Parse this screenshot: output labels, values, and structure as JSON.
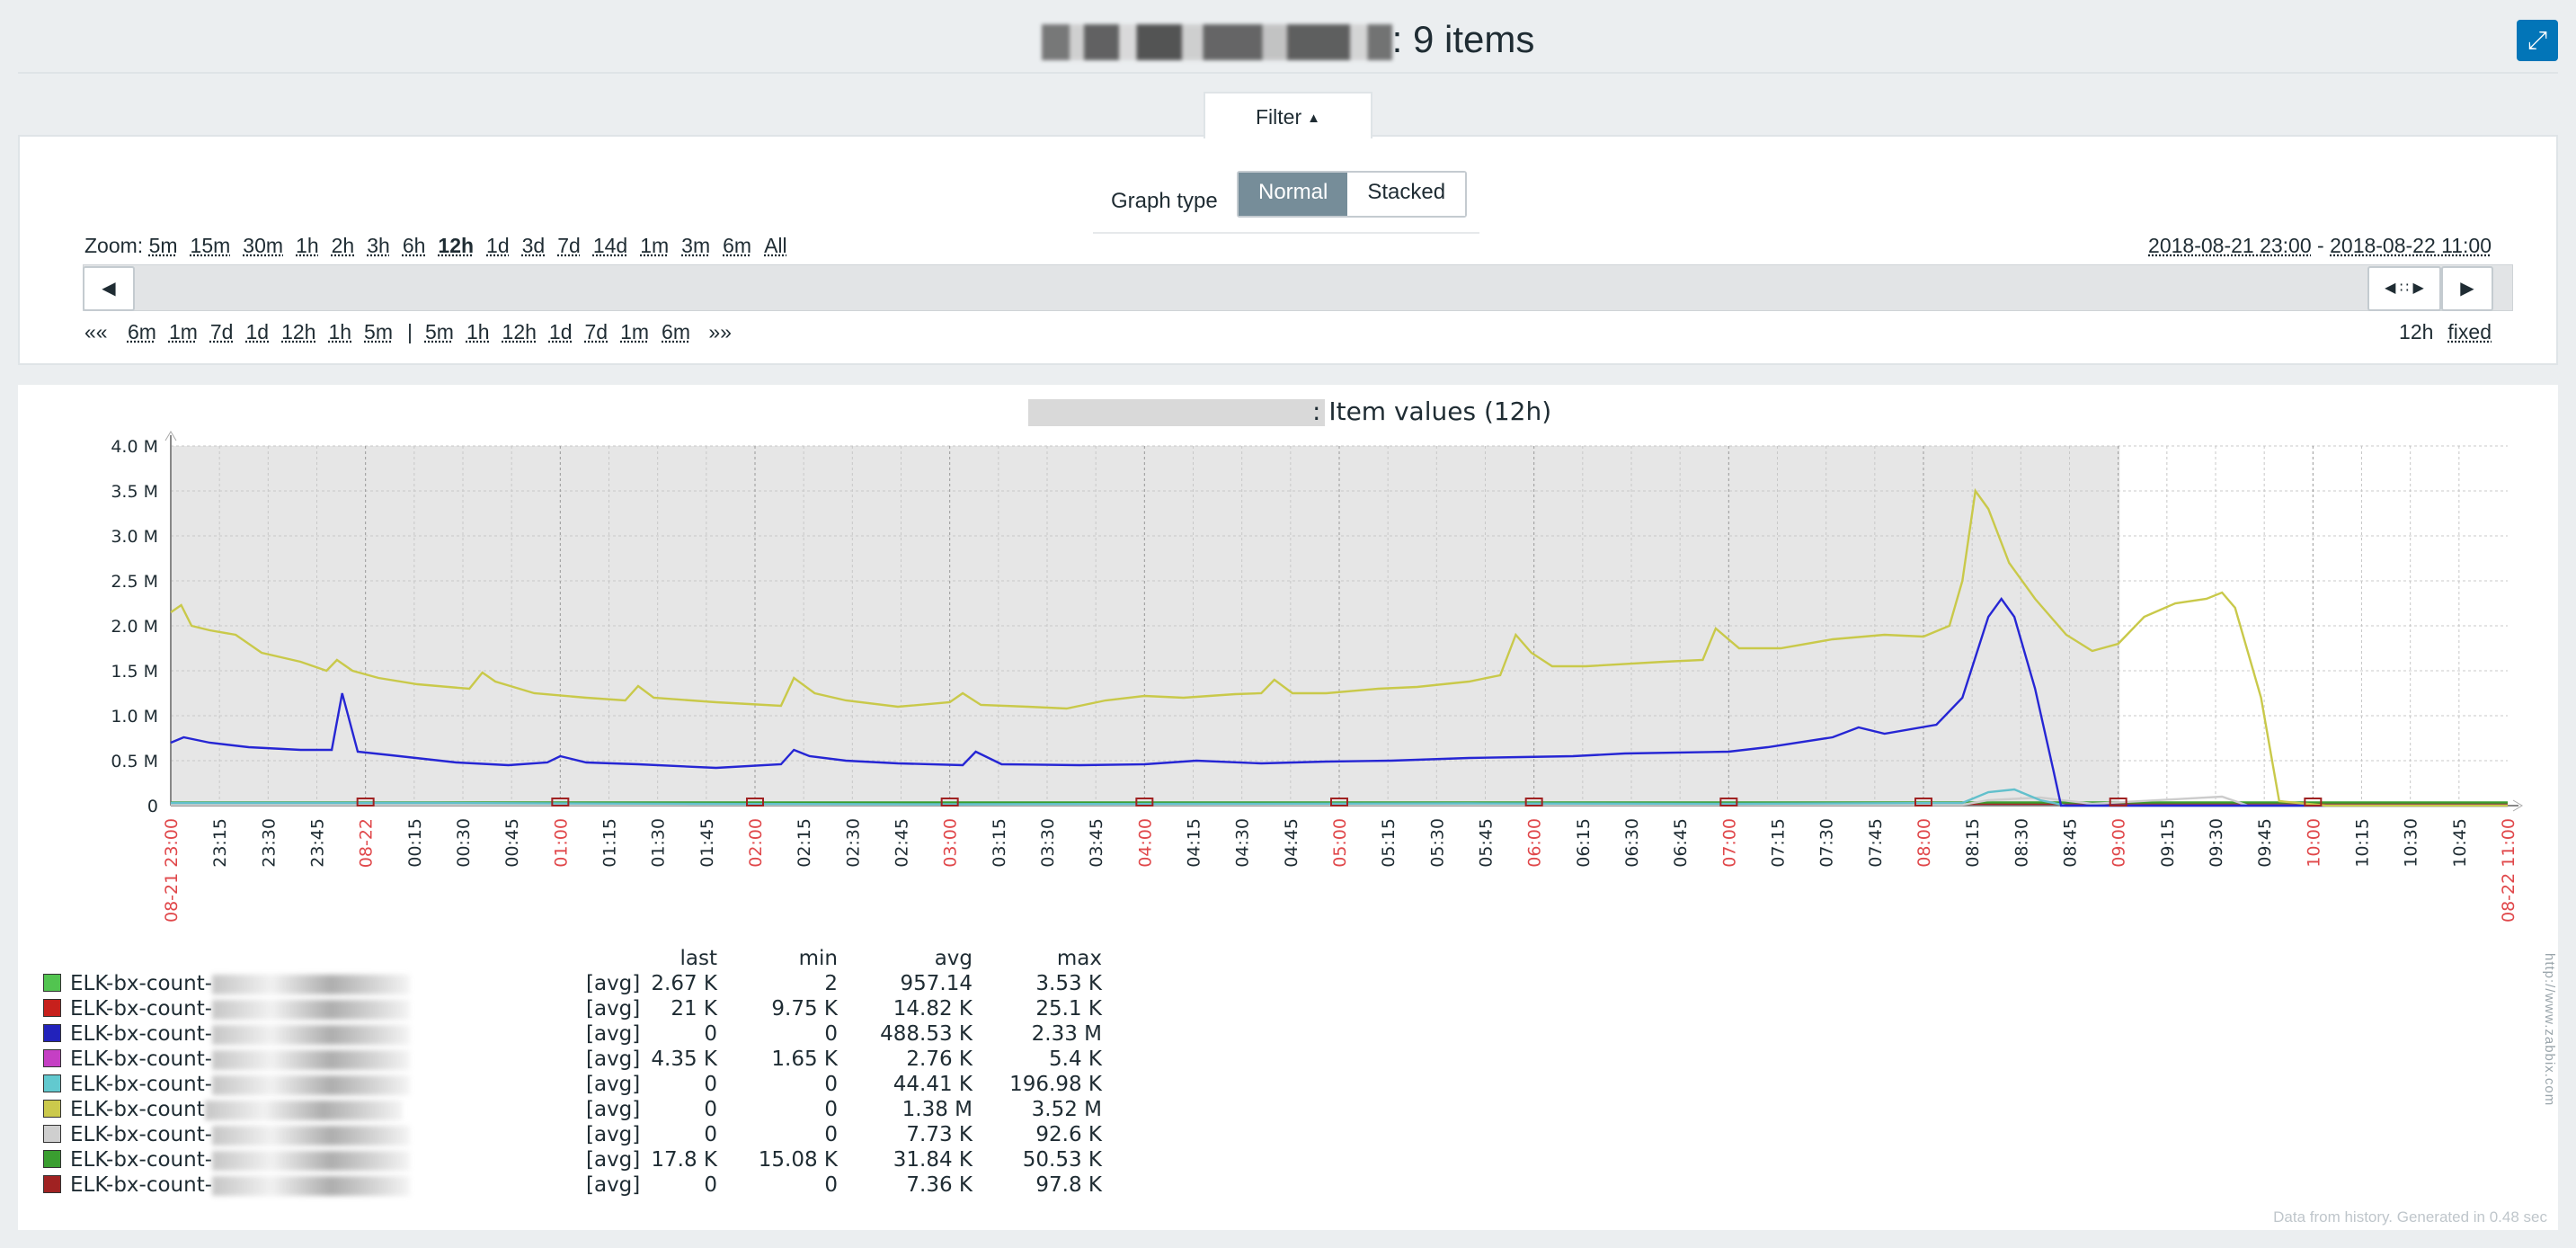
{
  "header": {
    "title_suffix": ": 9 items",
    "fullscreen_icon": "⤢"
  },
  "filter": {
    "tab_label": "Filter",
    "graph_type_label": "Graph type",
    "graph_types": [
      "Normal",
      "Stacked"
    ],
    "graph_type_selected": "Normal",
    "zoom_label": "Zoom:",
    "zoom_options": [
      "5m",
      "15m",
      "30m",
      "1h",
      "2h",
      "3h",
      "6h",
      "12h",
      "1d",
      "3d",
      "7d",
      "14d",
      "1m",
      "3m",
      "6m",
      "All"
    ],
    "zoom_selected": "12h",
    "range_from": "2018-08-21 23:00",
    "range_sep": " - ",
    "range_to": "2018-08-22 11:00",
    "nav_back_label": "««",
    "nav_back": [
      "6m",
      "1m",
      "7d",
      "1d",
      "12h",
      "1h",
      "5m"
    ],
    "nav_sep": "|",
    "nav_forward": [
      "5m",
      "1h",
      "12h",
      "1d",
      "7d",
      "1m",
      "6m"
    ],
    "nav_forward_label": "»»",
    "period": "12h",
    "fixed_label": "fixed"
  },
  "graph": {
    "title_suffix": ": Item values (12h)",
    "footer": "Data from history. Generated in 0.48 sec",
    "watermark": "http://www.zabbix.com",
    "y_ticks": [
      "0",
      "0.5 M",
      "1.0 M",
      "1.5 M",
      "2.0 M",
      "2.5 M",
      "3.0 M",
      "3.5 M",
      "4.0 M"
    ],
    "x_start_label": "08-21 23:00",
    "x_end_label": "08-22 11:00",
    "x_labels": [
      "23:15",
      "23:30",
      "23:45",
      "08-22",
      "00:15",
      "00:30",
      "00:45",
      "01:00",
      "01:15",
      "01:30",
      "01:45",
      "02:00",
      "02:15",
      "02:30",
      "02:45",
      "03:00",
      "03:15",
      "03:30",
      "03:45",
      "04:00",
      "04:15",
      "04:30",
      "04:45",
      "05:00",
      "05:15",
      "05:30",
      "05:45",
      "06:00",
      "06:15",
      "06:30",
      "06:45",
      "07:00",
      "07:15",
      "07:30",
      "07:45",
      "08:00",
      "08:15",
      "08:30",
      "08:45",
      "09:00",
      "09:15",
      "09:30",
      "09:45",
      "10:00",
      "10:15",
      "10:30",
      "10:45"
    ],
    "highlight_labels": [
      "08-22",
      "01:00",
      "02:00",
      "03:00",
      "04:00",
      "05:00",
      "06:00",
      "07:00",
      "08:00",
      "09:00",
      "10:00"
    ]
  },
  "chart_data": {
    "type": "line",
    "title": ": Item values (12h)",
    "ylim": [
      0,
      4000000
    ],
    "x_range": [
      "2018-08-21 23:00",
      "2018-08-22 11:00"
    ],
    "series": [
      {
        "name": "ELK-bx-count-",
        "color": "#c9c94a",
        "points": [
          [
            0,
            2150000
          ],
          [
            4,
            2230000
          ],
          [
            8,
            2000000
          ],
          [
            15,
            1950000
          ],
          [
            25,
            1900000
          ],
          [
            35,
            1700000
          ],
          [
            50,
            1600000
          ],
          [
            60,
            1500000
          ],
          [
            64,
            1620000
          ],
          [
            70,
            1500000
          ],
          [
            80,
            1420000
          ],
          [
            95,
            1350000
          ],
          [
            115,
            1300000
          ],
          [
            120,
            1480000
          ],
          [
            125,
            1380000
          ],
          [
            140,
            1250000
          ],
          [
            160,
            1200000
          ],
          [
            175,
            1170000
          ],
          [
            180,
            1330000
          ],
          [
            186,
            1200000
          ],
          [
            210,
            1150000
          ],
          [
            235,
            1110000
          ],
          [
            240,
            1420000
          ],
          [
            248,
            1250000
          ],
          [
            260,
            1170000
          ],
          [
            280,
            1100000
          ],
          [
            300,
            1150000
          ],
          [
            305,
            1250000
          ],
          [
            312,
            1120000
          ],
          [
            330,
            1100000
          ],
          [
            345,
            1080000
          ],
          [
            360,
            1170000
          ],
          [
            375,
            1220000
          ],
          [
            390,
            1200000
          ],
          [
            410,
            1240000
          ],
          [
            420,
            1250000
          ],
          [
            425,
            1400000
          ],
          [
            432,
            1250000
          ],
          [
            445,
            1250000
          ],
          [
            465,
            1300000
          ],
          [
            480,
            1320000
          ],
          [
            500,
            1380000
          ],
          [
            512,
            1450000
          ],
          [
            518,
            1900000
          ],
          [
            524,
            1700000
          ],
          [
            532,
            1550000
          ],
          [
            545,
            1550000
          ],
          [
            575,
            1600000
          ],
          [
            590,
            1620000
          ],
          [
            595,
            1970000
          ],
          [
            604,
            1750000
          ],
          [
            620,
            1750000
          ],
          [
            640,
            1850000
          ],
          [
            660,
            1900000
          ],
          [
            675,
            1880000
          ],
          [
            685,
            2000000
          ],
          [
            690,
            2500000
          ],
          [
            695,
            3500000
          ],
          [
            700,
            3300000
          ],
          [
            708,
            2700000
          ],
          [
            718,
            2300000
          ],
          [
            730,
            1900000
          ],
          [
            740,
            1720000
          ],
          [
            750,
            1800000
          ],
          [
            760,
            2100000
          ],
          [
            772,
            2250000
          ],
          [
            784,
            2300000
          ],
          [
            790,
            2370000
          ],
          [
            795,
            2200000
          ],
          [
            805,
            1200000
          ],
          [
            812,
            50000
          ],
          [
            830,
            0
          ],
          [
            900,
            0
          ]
        ]
      },
      {
        "name": "ELK-bx-count-",
        "color": "#2626d4",
        "points": [
          [
            0,
            700000
          ],
          [
            5,
            760000
          ],
          [
            15,
            700000
          ],
          [
            30,
            650000
          ],
          [
            50,
            620000
          ],
          [
            62,
            620000
          ],
          [
            66,
            1250000
          ],
          [
            72,
            600000
          ],
          [
            85,
            560000
          ],
          [
            110,
            480000
          ],
          [
            130,
            450000
          ],
          [
            145,
            480000
          ],
          [
            150,
            550000
          ],
          [
            160,
            480000
          ],
          [
            180,
            460000
          ],
          [
            210,
            420000
          ],
          [
            235,
            460000
          ],
          [
            240,
            620000
          ],
          [
            246,
            550000
          ],
          [
            260,
            500000
          ],
          [
            280,
            470000
          ],
          [
            305,
            450000
          ],
          [
            310,
            600000
          ],
          [
            320,
            460000
          ],
          [
            350,
            450000
          ],
          [
            375,
            460000
          ],
          [
            395,
            500000
          ],
          [
            420,
            470000
          ],
          [
            445,
            490000
          ],
          [
            470,
            500000
          ],
          [
            500,
            530000
          ],
          [
            520,
            540000
          ],
          [
            540,
            550000
          ],
          [
            560,
            580000
          ],
          [
            600,
            600000
          ],
          [
            615,
            650000
          ],
          [
            640,
            760000
          ],
          [
            650,
            870000
          ],
          [
            660,
            800000
          ],
          [
            680,
            900000
          ],
          [
            690,
            1200000
          ],
          [
            700,
            2100000
          ],
          [
            705,
            2300000
          ],
          [
            710,
            2100000
          ],
          [
            718,
            1300000
          ],
          [
            725,
            400000
          ],
          [
            728,
            0
          ],
          [
            900,
            0
          ]
        ]
      },
      {
        "name": "ELK-bx-count-",
        "color": "#62c0cc",
        "points": [
          [
            0,
            30000
          ],
          [
            100,
            30000
          ],
          [
            200,
            20000
          ],
          [
            300,
            15000
          ],
          [
            400,
            20000
          ],
          [
            500,
            25000
          ],
          [
            600,
            20000
          ],
          [
            690,
            30000
          ],
          [
            700,
            150000
          ],
          [
            710,
            180000
          ],
          [
            720,
            60000
          ],
          [
            730,
            0
          ],
          [
            900,
            0
          ]
        ]
      },
      {
        "name": "ELK-bx-count-",
        "color": "#cccccc",
        "points": [
          [
            0,
            10000
          ],
          [
            690,
            10000
          ],
          [
            700,
            60000
          ],
          [
            720,
            90000
          ],
          [
            740,
            20000
          ],
          [
            790,
            100000
          ],
          [
            800,
            0
          ],
          [
            900,
            0
          ]
        ]
      },
      {
        "name": "ELK-bx-count-",
        "color": "#3a9e30",
        "points": [
          [
            0,
            35000
          ],
          [
            900,
            35000
          ]
        ]
      },
      {
        "name": "ELK-bx-count-",
        "color": "#a02222",
        "points": [
          [
            0,
            20000
          ],
          [
            900,
            20000
          ]
        ]
      }
    ]
  },
  "legend": {
    "headers": [
      "last",
      "min",
      "avg",
      "max"
    ],
    "rows": [
      {
        "color": "#52c450",
        "name": "ELK-bx-count-",
        "func": "[avg]",
        "last": "2.67 K",
        "min": "2",
        "avg": "957.14",
        "max": "3.53 K"
      },
      {
        "color": "#c7201c",
        "name": "ELK-bx-count-",
        "func": "[avg]",
        "last": "21 K",
        "min": "9.75 K",
        "avg": "14.82 K",
        "max": "25.1 K"
      },
      {
        "color": "#2222bb",
        "name": "ELK-bx-count-",
        "func": "[avg]",
        "last": "0",
        "min": "0",
        "avg": "488.53 K",
        "max": "2.33 M"
      },
      {
        "color": "#c53fc4",
        "name": "ELK-bx-count-",
        "func": "[avg]",
        "last": "4.35 K",
        "min": "1.65 K",
        "avg": "2.76 K",
        "max": "5.4 K"
      },
      {
        "color": "#62c9cf",
        "name": "ELK-bx-count-",
        "func": "[avg]",
        "last": "0",
        "min": "0",
        "avg": "44.41 K",
        "max": "196.98 K"
      },
      {
        "color": "#cbc94c",
        "name": "ELK-bx-count",
        "func": "[avg]",
        "last": "0",
        "min": "0",
        "avg": "1.38 M",
        "max": "3.52 M"
      },
      {
        "color": "#cfcfcf",
        "name": "ELK-bx-count-",
        "func": "[avg]",
        "last": "0",
        "min": "0",
        "avg": "7.73 K",
        "max": "92.6 K"
      },
      {
        "color": "#3a9e30",
        "name": "ELK-bx-count-",
        "func": "[avg]",
        "last": "17.8 K",
        "min": "15.08 K",
        "avg": "31.84 K",
        "max": "50.53 K"
      },
      {
        "color": "#a02222",
        "name": "ELK-bx-count-",
        "func": "[avg]",
        "last": "0",
        "min": "0",
        "avg": "7.36 K",
        "max": "97.8 K"
      }
    ]
  }
}
